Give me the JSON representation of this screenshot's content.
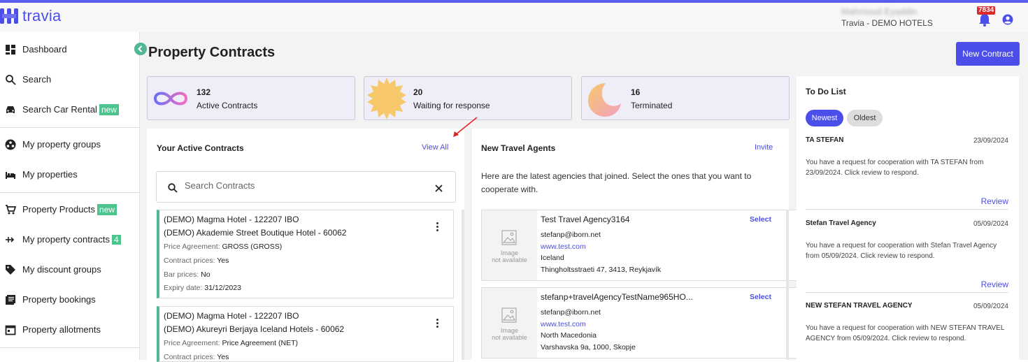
{
  "app": {
    "logo_text": "travia",
    "brand_color": "#4b4ee8",
    "accent_color": "#53b796"
  },
  "header": {
    "user_name": "Mahmoud Eyaddin",
    "company": "Travia - DEMO HOTELS",
    "notification_count": "7834",
    "icons": [
      "bell-icon",
      "account-icon"
    ]
  },
  "sidebar": {
    "items": [
      {
        "label": "Dashboard",
        "icon": "dashboard-icon"
      },
      {
        "label": "Search",
        "icon": "search-icon"
      },
      {
        "label": "Search Car Rental",
        "icon": "car-icon",
        "badge": "new"
      },
      {
        "label": "My property groups",
        "icon": "groups-icon"
      },
      {
        "label": "My properties",
        "icon": "bed-icon"
      },
      {
        "label": "Property Products",
        "icon": "cart-icon",
        "badge": "new"
      },
      {
        "label": "My property contracts",
        "icon": "contracts-icon",
        "badge": "4"
      },
      {
        "label": "My discount groups",
        "icon": "tag-icon"
      },
      {
        "label": "Property bookings",
        "icon": "bookings-icon"
      },
      {
        "label": "Property allotments",
        "icon": "calendar-icon"
      }
    ]
  },
  "page": {
    "title": "Property Contracts",
    "new_contract_label": "New Contract"
  },
  "stats": [
    {
      "value": "132",
      "label": "Active Contracts",
      "icon": "infinity-icon"
    },
    {
      "value": "20",
      "label": "Waiting for response",
      "icon": "sun-icon"
    },
    {
      "value": "16",
      "label": "Terminated",
      "icon": "moon-icon"
    }
  ],
  "active_contracts": {
    "title": "Your Active Contracts",
    "view_all": "View All",
    "search_placeholder": "Search Contracts",
    "contracts": [
      {
        "line1": "(DEMO) Magma Hotel - 122207 IBO",
        "line2": "(DEMO) Akademie Street Boutique Hotel - 60062",
        "price_agreement_label": "Price Agreement:",
        "price_agreement": "GROSS (GROSS)",
        "contract_prices_label": "Contract prices:",
        "contract_prices": "Yes",
        "bar_prices_label": "Bar prices:",
        "bar_prices": "No",
        "expiry_label": "Expiry date:",
        "expiry": "31/12/2023"
      },
      {
        "line1": "(DEMO) Magma Hotel - 122207 IBO",
        "line2": "(DEMO) Akureyri Berjaya Iceland Hotels - 60062",
        "price_agreement_label": "Price Agreement:",
        "price_agreement": "Price Agreement (NET)",
        "contract_prices_label": "Contract prices:",
        "contract_prices": "Yes"
      }
    ]
  },
  "travel_agents": {
    "title": "New Travel Agents",
    "invite": "Invite",
    "description": "Here are the latest agencies that joined. Select the ones that you want to cooperate with.",
    "image_na_1": "Image",
    "image_na_2": "not available",
    "select_label": "Select",
    "agents": [
      {
        "name": "Test Travel Agency3164",
        "email": "stefanp@iborn.net",
        "website": "www.test.com",
        "country": "Iceland",
        "address": "Thingholtsstraeti 47, 3413, Reykjavík"
      },
      {
        "name": "stefanp+travelAgencyTestName965HO...",
        "email": "stefanp@iborn.net",
        "website": "www.test.com",
        "country": "North Macedonia",
        "address": "Varshavska 9a, 1000, Skopje"
      }
    ]
  },
  "todo": {
    "title": "To Do List",
    "newest": "Newest",
    "oldest": "Oldest",
    "review": "Review",
    "items": [
      {
        "title": "TA STEFAN",
        "date": "23/09/2024",
        "text": "You have a request for cooperation with TA STEFAN from 23/09/2024. Click review to respond."
      },
      {
        "title": "Stefan Travel Agency",
        "date": "05/09/2024",
        "text": "You have a request for cooperation with Stefan Travel Agency from 05/09/2024. Click review to respond."
      },
      {
        "title": "NEW STEFAN TRAVEL AGENCY",
        "date": "05/09/2024",
        "text": "You have a request for cooperation with NEW STEFAN TRAVEL AGENCY from 05/09/2024. Click review to respond."
      }
    ]
  }
}
